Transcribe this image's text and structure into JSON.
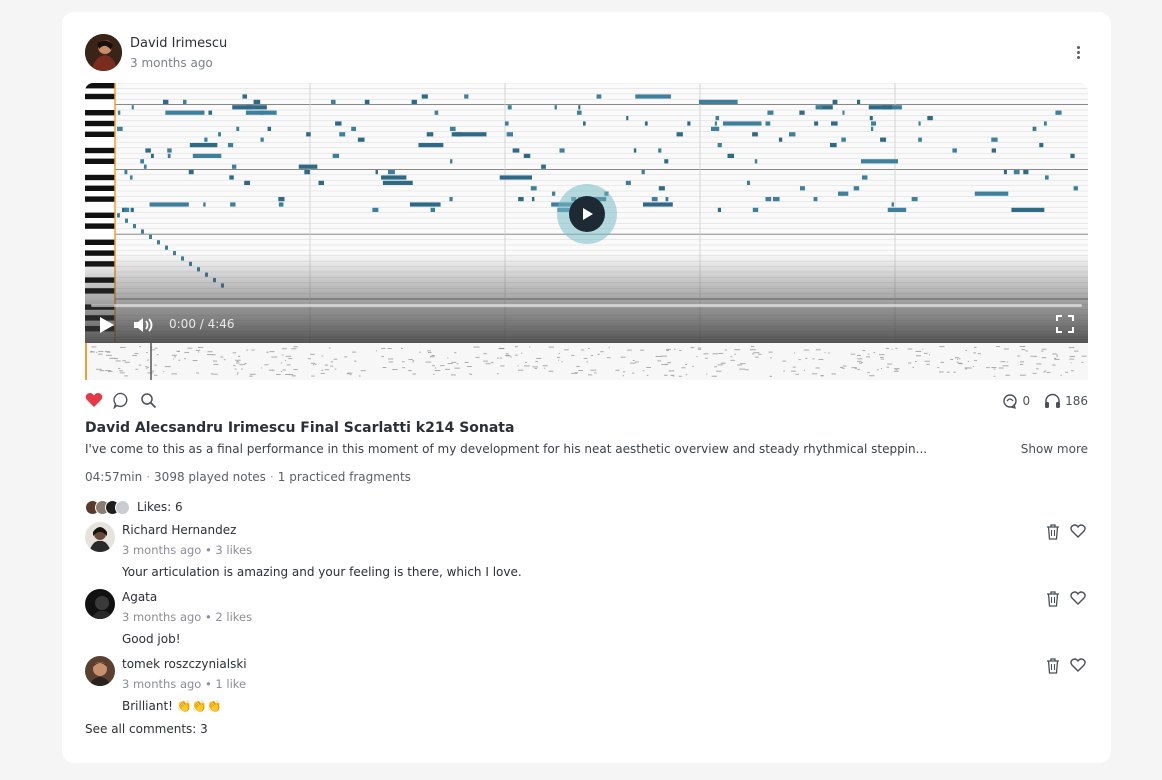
{
  "post": {
    "author": "David Irimescu",
    "time": "3 months ago",
    "title": "David Alecsandru Irimescu Final Scarlatti k214 Sonata",
    "description": "I've come to this as a final performance in this moment of my development for his neat aesthetic overview and steady rhythmical steppin...",
    "show_more": "Show more",
    "duration": "04:57min",
    "played_notes": "3098 played notes",
    "fragments": "1 practiced fragments",
    "likes_label": "Likes: 6",
    "reposts": "0",
    "listens": "186",
    "see_all_comments": "See all comments: 3"
  },
  "player": {
    "time": "0:00 / 4:46",
    "progress": 0
  },
  "icons": {
    "like": "heart-filled-icon",
    "comment": "speech-bubble-icon",
    "search": "magnifier-icon",
    "repost": "repost-icon",
    "listens": "headphones-icon",
    "delete": "trash-icon",
    "comment_like": "heart-outline-icon",
    "menu": "kebab-menu-icon"
  },
  "colors": {
    "accent_like": "#e53945",
    "note_blue": "#3e7f9b",
    "play_ring": "#7fc2cb"
  },
  "comments": [
    {
      "name": "Richard Hernandez",
      "meta": "3 months ago • 3 likes",
      "text": "Your articulation is amazing and your feeling is there, which I love."
    },
    {
      "name": "Agata",
      "meta": "3 months ago • 2 likes",
      "text": "Good job!"
    },
    {
      "name": "tomek roszczynialski",
      "meta": "3 months ago • 1 like",
      "text": "Brilliant! 👏👏👏"
    }
  ]
}
